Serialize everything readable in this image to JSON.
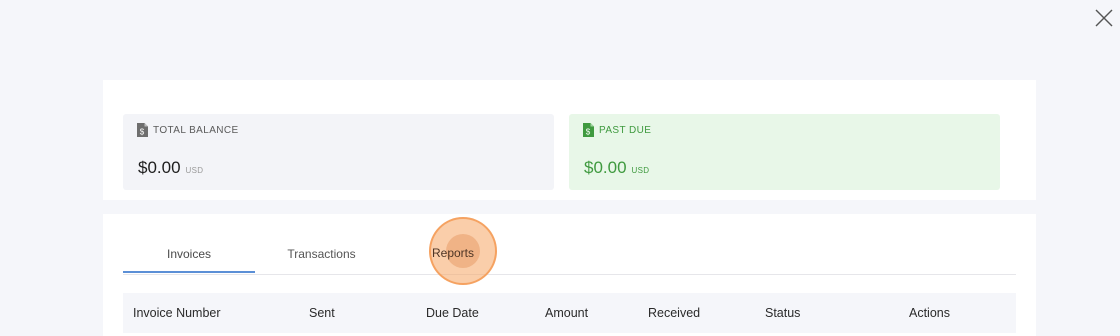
{
  "modal": {
    "close_icon": "close-icon"
  },
  "summary": {
    "total_balance": {
      "label": "TOTAL BALANCE",
      "amount": "$0.00",
      "currency": "USD",
      "icon": "invoice-dollar-icon",
      "color": "#1e1e1e"
    },
    "past_due": {
      "label": "PAST DUE",
      "amount": "$0.00",
      "currency": "USD",
      "icon": "invoice-dollar-icon",
      "color": "#3f9a3f"
    }
  },
  "tabs": [
    {
      "label": "Invoices",
      "active": true
    },
    {
      "label": "Transactions",
      "active": false
    },
    {
      "label": "Reports",
      "active": false,
      "highlighted": true
    }
  ],
  "table": {
    "columns": [
      "Invoice Number",
      "Sent",
      "Due Date",
      "Amount",
      "Received",
      "Status",
      "Actions"
    ]
  },
  "colors": {
    "accent": "#5b8fd6",
    "highlight": "#f5a664",
    "success": "#3f9a3f"
  }
}
